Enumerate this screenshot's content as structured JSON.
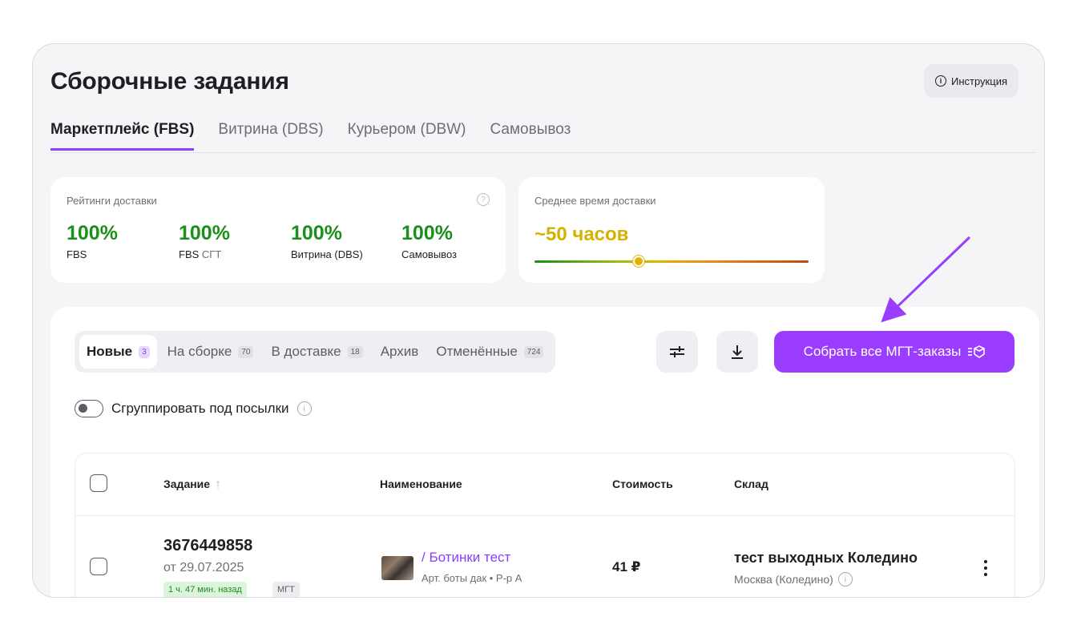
{
  "page": {
    "title": "Сборочные задания",
    "instruction_label": "Инструкция"
  },
  "tabs": [
    {
      "label": "Маркетплейс (FBS)",
      "active": true
    },
    {
      "label": "Витрина (DBS)",
      "active": false
    },
    {
      "label": "Курьером (DBW)",
      "active": false
    },
    {
      "label": "Самовывоз",
      "active": false
    }
  ],
  "ratings_card": {
    "title": "Рейтинги доставки",
    "items": [
      {
        "value": "100%",
        "label": "FBS",
        "suffix": ""
      },
      {
        "value": "100%",
        "label": "FBS",
        "suffix": " СГТ"
      },
      {
        "value": "100%",
        "label": "Витрина (DBS)",
        "suffix": ""
      },
      {
        "value": "100%",
        "label": "Самовывоз",
        "suffix": ""
      }
    ]
  },
  "delivery_time_card": {
    "title": "Среднее время доставки",
    "value": "~50 часов",
    "scale_position": 0.38
  },
  "status_tabs": [
    {
      "label": "Новые",
      "count": "3",
      "active": true
    },
    {
      "label": "На сборке",
      "count": "70",
      "active": false
    },
    {
      "label": "В доставке",
      "count": "18",
      "active": false
    },
    {
      "label": "Архив",
      "count": "",
      "active": false
    },
    {
      "label": "Отменённые",
      "count": "724",
      "active": false
    }
  ],
  "actions": {
    "collect_all_label": "Собрать все МГТ-заказы"
  },
  "group_toggle": {
    "label": "Сгруппировать под посылки",
    "enabled": false
  },
  "table": {
    "columns": {
      "task": "Задание",
      "name": "Наименование",
      "price": "Стоимость",
      "warehouse": "Склад"
    },
    "rows": [
      {
        "id": "3676449858",
        "date": "от 29.07.2025",
        "age_tag": "1 ч. 47 мин. назад",
        "type_tag": "МГТ",
        "product_name": "/ Ботинки тест",
        "product_meta": "Арт. боты дак • Р-р А",
        "price": "41 ₽",
        "warehouse": "тест выходных Коледино",
        "warehouse_city": "Москва (Коледино)"
      }
    ]
  },
  "colors": {
    "accent": "#9b3dff",
    "rating_green": "#1a8f1a",
    "time_yellow": "#d6b100"
  }
}
